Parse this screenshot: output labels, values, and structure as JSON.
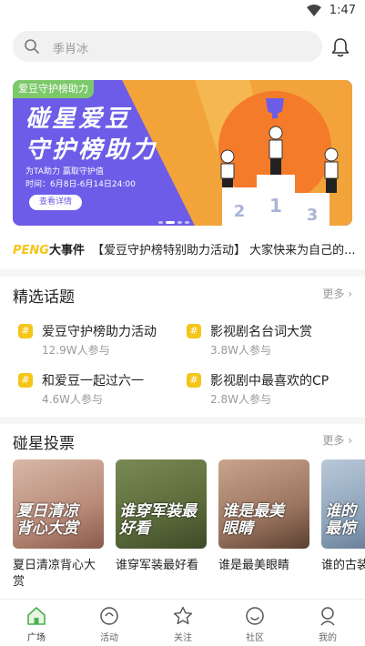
{
  "status_bar": {
    "time": "1:47"
  },
  "search": {
    "placeholder": "季肖冰"
  },
  "banner": {
    "tag": "爱豆守护榜助力",
    "headline_1": "碰星爱豆",
    "headline_2": "守护榜助力",
    "sub_1": "为TA助力 赢取守护值",
    "sub_2": "时间：6月8日-6月14日24:00",
    "button": "查看详情",
    "podium": [
      "2",
      "1",
      "3"
    ]
  },
  "news": {
    "brand_1": "PENG",
    "brand_2": "大事件",
    "text": "【爱豆守护榜特别助力活动】 大家快来为自己的..."
  },
  "topics": {
    "title": "精选话题",
    "more": "更多",
    "items": [
      {
        "name": "爱豆守护榜助力活动",
        "sub": "12.9W人参与"
      },
      {
        "name": "影视剧名台词大赏",
        "sub": "3.8W人参与"
      },
      {
        "name": "和爱豆一起过六一",
        "sub": "4.6W人参与"
      },
      {
        "name": "影视剧中最喜欢的CP",
        "sub": "2.8W人参与"
      }
    ]
  },
  "votes": {
    "title": "碰星投票",
    "more": "更多",
    "items": [
      {
        "image_text": "夏日清凉背心大赏",
        "caption": "夏日清凉背心大赏"
      },
      {
        "image_text": "谁穿军装最好看",
        "caption": "谁穿军装最好看"
      },
      {
        "image_text": "谁是最美眼睛",
        "caption": "谁是最美眼睛"
      },
      {
        "image_text": "谁的最惊",
        "caption": "谁的古装"
      }
    ]
  },
  "tabbar": {
    "items": [
      {
        "label": "广场",
        "icon": "home-icon",
        "active": true
      },
      {
        "label": "活动",
        "icon": "activity-icon",
        "active": false
      },
      {
        "label": "关注",
        "icon": "star-icon",
        "active": false
      },
      {
        "label": "社区",
        "icon": "community-icon",
        "active": false
      },
      {
        "label": "我的",
        "icon": "profile-icon",
        "active": false
      }
    ]
  },
  "colors": {
    "accent_yellow": "#f5c518",
    "banner_purple": "#6c5ce7",
    "tab_active_green": "#4caf50",
    "banner_tag_green": "#7cc96b"
  }
}
